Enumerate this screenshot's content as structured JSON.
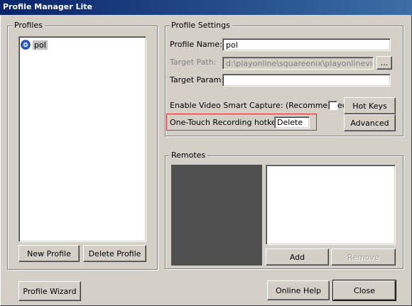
{
  "window": {
    "title": "Profile Manager Lite"
  },
  "profiles": {
    "group_title": "Profiles",
    "items": [
      {
        "label": "pol",
        "icon": "playonline-icon"
      }
    ],
    "new_button": "New Profile",
    "delete_button": "Delete Profile"
  },
  "settings": {
    "group_title": "Profile Settings",
    "profile_name_label": "Profile Name:",
    "profile_name_value": "pol",
    "target_path_label": "Target Path:",
    "target_path_value": "d:\\playonline\\squareenix\\playonlineviewer\\",
    "browse_button": "...",
    "target_param_label": "Target Param:",
    "target_param_value": "",
    "smart_capture_label": "Enable Video Smart Capture: (Recommended)",
    "smart_capture_checked": false,
    "hot_keys_button": "Hot Keys",
    "hotkey_label": "One-Touch Recording hotkey:",
    "hotkey_value": "Delete",
    "advanced_button": "Advanced",
    "highlight_color": "#e0282c"
  },
  "remotes": {
    "group_title": "Remotes",
    "add_button": "Add",
    "remove_button": "Remove",
    "preview_color": "#505050"
  },
  "footer": {
    "wizard_button": "Profile Wizard",
    "help_button": "Online Help",
    "close_button": "Close"
  }
}
